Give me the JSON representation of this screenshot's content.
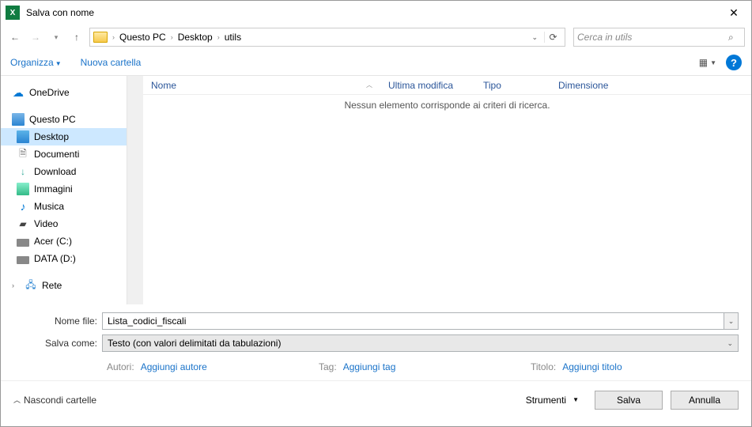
{
  "title": "Salva con nome",
  "breadcrumb": {
    "items": [
      "Questo PC",
      "Desktop",
      "utils"
    ]
  },
  "search": {
    "placeholder": "Cerca in utils"
  },
  "toolbar": {
    "organize": "Organizza",
    "new_folder": "Nuova cartella"
  },
  "columns": {
    "name": "Nome",
    "modified": "Ultima modifica",
    "type": "Tipo",
    "size": "Dimensione"
  },
  "empty_message": "Nessun elemento corrisponde ai criteri di ricerca.",
  "sidebar": {
    "onedrive": "OneDrive",
    "thispc": "Questo PC",
    "desktop": "Desktop",
    "documents": "Documenti",
    "download": "Download",
    "images": "Immagini",
    "music": "Musica",
    "video": "Video",
    "drive_c": "Acer (C:)",
    "drive_d": "DATA (D:)",
    "network": "Rete"
  },
  "form": {
    "filename_label": "Nome file:",
    "filename_value": "Lista_codici_fiscali",
    "savetype_label": "Salva come:",
    "savetype_value": "Testo (con valori delimitati da tabulazioni)",
    "authors_label": "Autori:",
    "authors_value": "Aggiungi autore",
    "tag_label": "Tag:",
    "tag_value": "Aggiungi tag",
    "title_label": "Titolo:",
    "title_value": "Aggiungi titolo"
  },
  "footer": {
    "hide_folders": "Nascondi cartelle",
    "tools": "Strumenti",
    "save": "Salva",
    "cancel": "Annulla"
  }
}
